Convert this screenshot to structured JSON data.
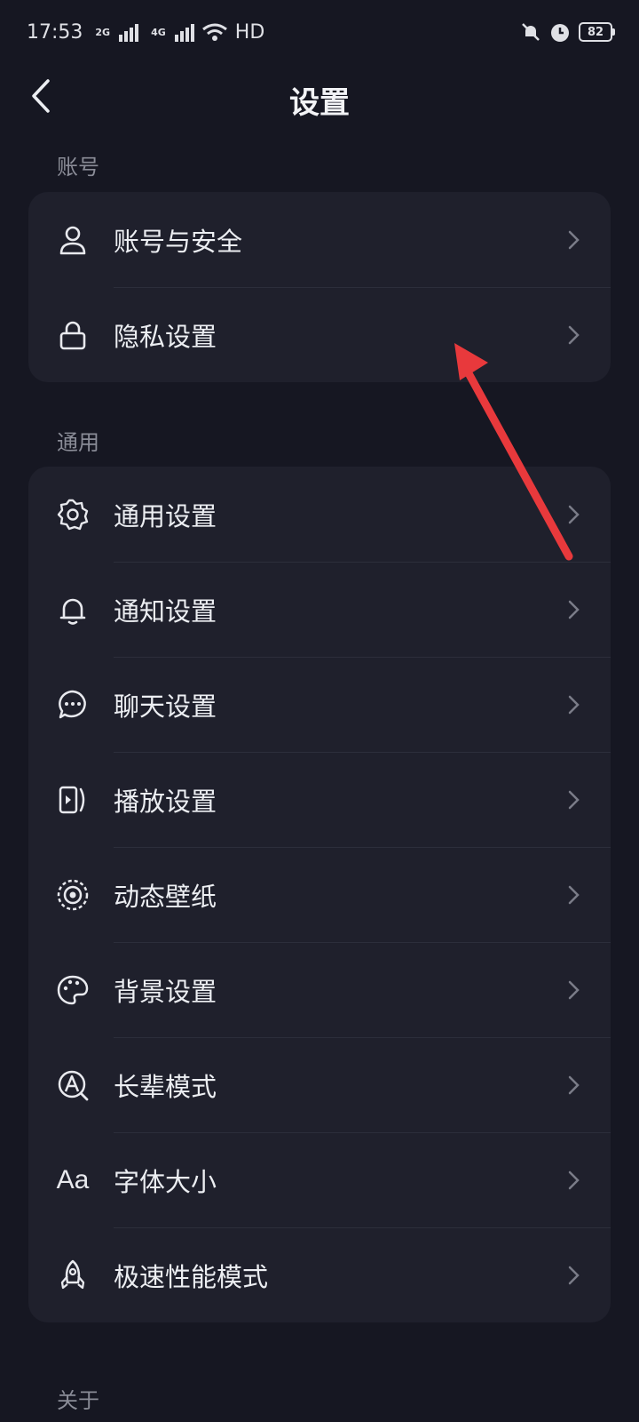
{
  "status_bar": {
    "time": "17:53",
    "net1": "2G",
    "net2": "4G",
    "hd": "HD",
    "battery": "82"
  },
  "nav": {
    "title": "设置",
    "back_icon": "chevron-left-icon"
  },
  "sections": {
    "account": {
      "label": "账号",
      "items": [
        {
          "label": "账号与安全",
          "icon": "user-icon"
        },
        {
          "label": "隐私设置",
          "icon": "lock-icon"
        }
      ]
    },
    "general": {
      "label": "通用",
      "items": [
        {
          "label": "通用设置",
          "icon": "gear-icon"
        },
        {
          "label": "通知设置",
          "icon": "bell-icon"
        },
        {
          "label": "聊天设置",
          "icon": "chat-bubble-icon"
        },
        {
          "label": "播放设置",
          "icon": "play-icon"
        },
        {
          "label": "动态壁纸",
          "icon": "live-wallpaper-icon"
        },
        {
          "label": "背景设置",
          "icon": "palette-icon"
        },
        {
          "label": "长辈模式",
          "icon": "elder-mode-icon"
        },
        {
          "label": "字体大小",
          "icon": "font-size-icon",
          "glyph": "Aa"
        },
        {
          "label": "极速性能模式",
          "icon": "rocket-icon"
        }
      ]
    },
    "about": {
      "label": "关于"
    }
  },
  "colors": {
    "background": "#161722",
    "card": "#1f202c",
    "annotation_arrow": "#e8393c"
  }
}
